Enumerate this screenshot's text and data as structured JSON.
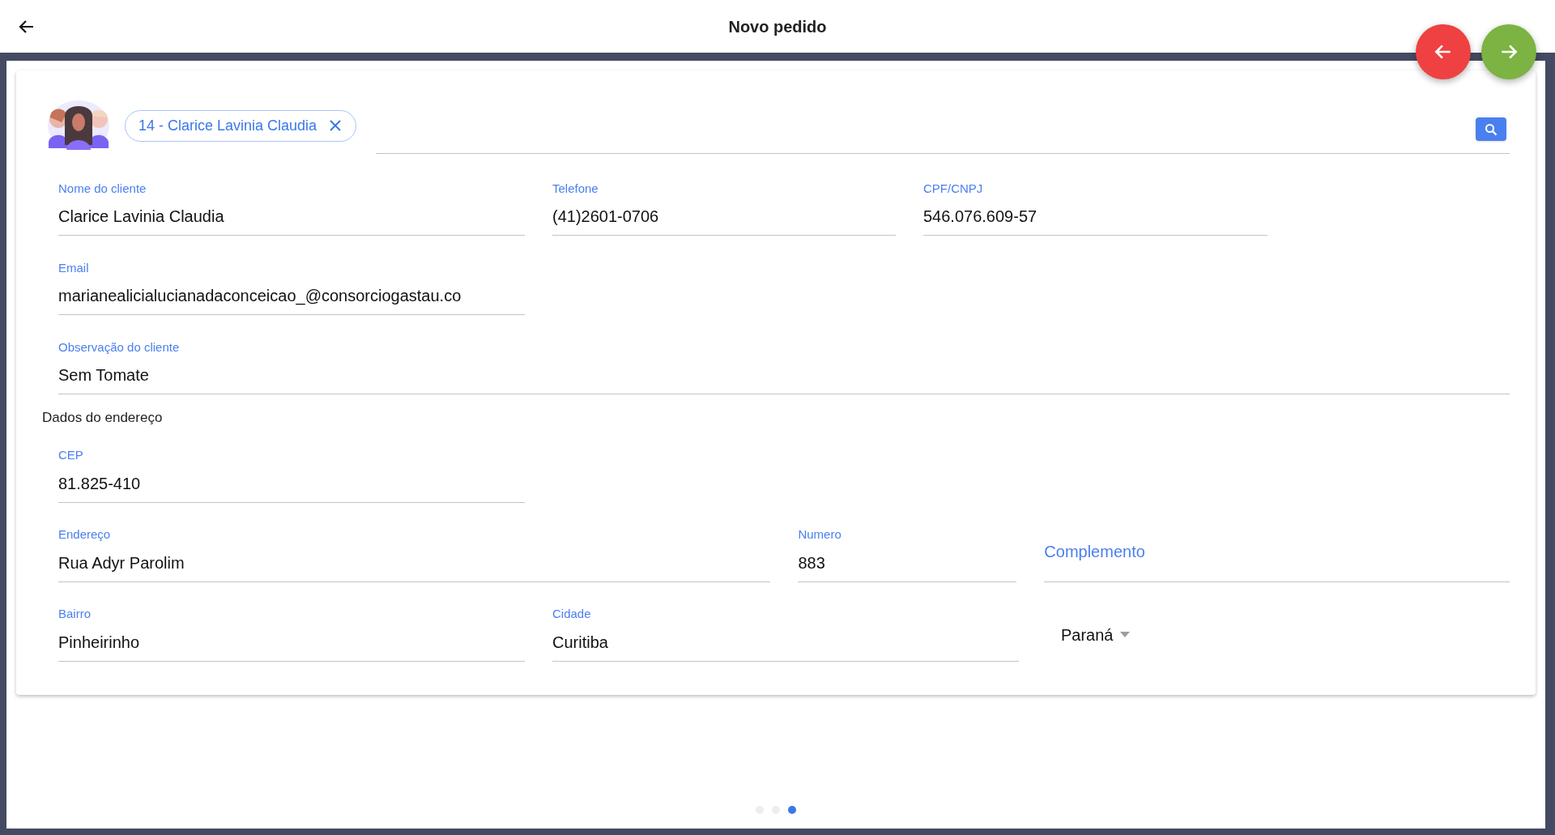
{
  "header": {
    "title": "Novo pedido"
  },
  "customer_chip": {
    "label": "14 - Clarice Lavinia Claudia"
  },
  "field_rows": [
    [
      {
        "kind": "text",
        "label": "Nome do cliente",
        "value": "Clarice Lavinia Claudia"
      },
      {
        "kind": "text",
        "label": "Telefone",
        "value": "(41)2601-0706"
      },
      {
        "kind": "text",
        "label": "CPF/CNPJ",
        "value": "546.076.609-57"
      }
    ],
    [
      {
        "kind": "text",
        "label": "Email",
        "value": "marianealicialucianadaconceicao_@consorciogastau.co"
      }
    ],
    [
      {
        "kind": "text",
        "label": "Observação do cliente",
        "value": "Sem Tomate"
      }
    ]
  ],
  "section_title": "Dados do endereço",
  "address_rows": [
    [
      {
        "kind": "text",
        "label": "CEP",
        "value": "81.825-410"
      }
    ],
    [
      {
        "kind": "text",
        "label": "Endereço",
        "value": "Rua Adyr Parolim"
      },
      {
        "kind": "text",
        "label": "Numero",
        "value": "883"
      },
      {
        "kind": "text",
        "label": "Complemento"
      }
    ],
    [
      {
        "kind": "text",
        "label": "Bairro",
        "value": "Pinheirinho"
      },
      {
        "kind": "text",
        "label": "Cidade",
        "value": "Curitiba"
      },
      {
        "kind": "select",
        "value": "Paraná"
      }
    ]
  ],
  "pager": [
    {
      "selected": false
    },
    {
      "selected": false
    },
    {
      "selected": true
    }
  ]
}
